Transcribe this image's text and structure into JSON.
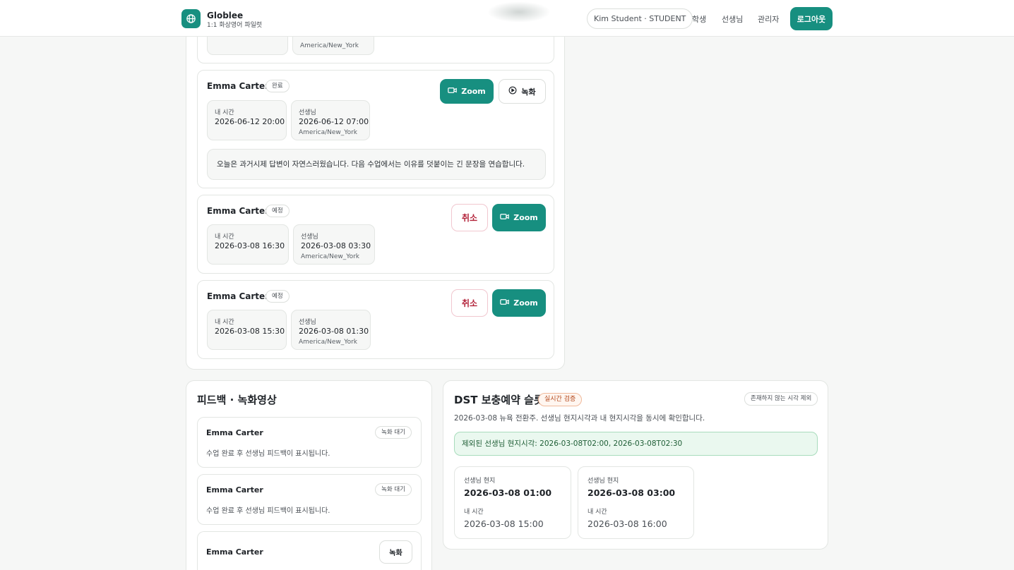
{
  "header": {
    "brand": "Globlee",
    "brand_sub": "1:1 화상영어 파일럿",
    "user_pill": "Kim Student · STUDENT",
    "nav": [
      "학생",
      "선생님",
      "관리자"
    ],
    "logout": "로그아웃"
  },
  "lessons": {
    "top_tz": "America/New_York",
    "items": [
      {
        "teacher": "Emma Carter",
        "status": "완료",
        "my_label": "내 시간",
        "my_time": "2026-06-12 20:00",
        "teacher_label": "선생님",
        "teacher_time": "2026-06-12 07:00",
        "teacher_tz": "America/New_York",
        "zoom": "Zoom",
        "recording": "녹화",
        "note": "오늘은 과거시제 답변이 자연스러웠습니다. 다음 수업에서는 이유를 덧붙이는 긴 문장을 연습합니다."
      },
      {
        "teacher": "Emma Carter",
        "status": "예정",
        "my_label": "내 시간",
        "my_time": "2026-03-08 16:30",
        "teacher_label": "선생님",
        "teacher_time": "2026-03-08 03:30",
        "teacher_tz": "America/New_York",
        "cancel": "취소",
        "zoom": "Zoom"
      },
      {
        "teacher": "Emma Carter",
        "status": "예정",
        "my_label": "내 시간",
        "my_time": "2026-03-08 15:30",
        "teacher_label": "선생님",
        "teacher_time": "2026-03-08 01:30",
        "teacher_tz": "America/New_York",
        "cancel": "취소",
        "zoom": "Zoom"
      }
    ]
  },
  "feedback": {
    "title": "피드백 · 녹화영상",
    "items": [
      {
        "teacher": "Emma Carter",
        "badge": "녹화 대기",
        "text": "수업 완료 후 선생님 피드백이 표시됩니다."
      },
      {
        "teacher": "Emma Carter",
        "badge": "녹화 대기",
        "text": "수업 완료 후 선생님 피드백이 표시됩니다."
      },
      {
        "teacher": "Emma Carter",
        "button": "녹화"
      }
    ]
  },
  "dst": {
    "title": "DST 보충예약 슬롯",
    "verify_badge": "실시간 검증",
    "exclude_badge": "존재하지 않는 시각 제외",
    "desc": "2026-03-08 뉴욕 전환주. 선생님 현지시각과 내 현지시각을 동시에 확인합니다.",
    "excluded": "제외된 선생님 현지시각: 2026-03-08T02:00, 2026-03-08T02:30",
    "slots": [
      {
        "teacher_label": "선생님 현지",
        "teacher_time": "2026-03-08 01:00",
        "my_label": "내 시간",
        "my_time": "2026-03-08 15:00"
      },
      {
        "teacher_label": "선생님 현지",
        "teacher_time": "2026-03-08 03:00",
        "my_label": "내 시간",
        "my_time": "2026-03-08 16:00"
      }
    ]
  },
  "colors": {
    "accent": "#178f80",
    "danger": "#b3233a",
    "success_bg": "#eaf8ef"
  }
}
